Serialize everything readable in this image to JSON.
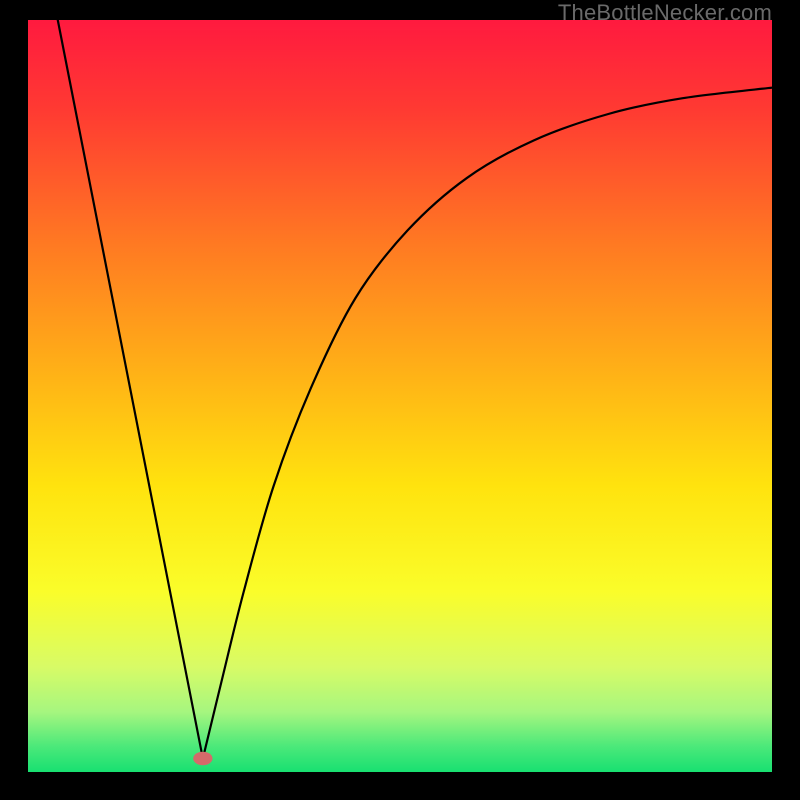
{
  "watermark": "TheBottleNecker.com",
  "chart_data": {
    "type": "line",
    "title": "",
    "xlabel": "",
    "ylabel": "",
    "xlim": [
      0,
      1
    ],
    "ylim": [
      0,
      1
    ],
    "gradient_stops": [
      {
        "offset": 0.0,
        "color": "#ff1a3f"
      },
      {
        "offset": 0.12,
        "color": "#ff3a32"
      },
      {
        "offset": 0.3,
        "color": "#ff7a22"
      },
      {
        "offset": 0.48,
        "color": "#ffb516"
      },
      {
        "offset": 0.62,
        "color": "#ffe30e"
      },
      {
        "offset": 0.76,
        "color": "#fafd2a"
      },
      {
        "offset": 0.86,
        "color": "#d8fb66"
      },
      {
        "offset": 0.92,
        "color": "#a6f67f"
      },
      {
        "offset": 0.965,
        "color": "#4de97a"
      },
      {
        "offset": 1.0,
        "color": "#18e071"
      }
    ],
    "curve": {
      "minimum_x": 0.235,
      "left_branch": [
        {
          "x": 0.04,
          "y": 1.0
        },
        {
          "x": 0.235,
          "y": 0.018
        }
      ],
      "right_branch": [
        {
          "x": 0.235,
          "y": 0.018
        },
        {
          "x": 0.26,
          "y": 0.12
        },
        {
          "x": 0.29,
          "y": 0.24
        },
        {
          "x": 0.33,
          "y": 0.38
        },
        {
          "x": 0.38,
          "y": 0.51
        },
        {
          "x": 0.44,
          "y": 0.63
        },
        {
          "x": 0.51,
          "y": 0.72
        },
        {
          "x": 0.59,
          "y": 0.79
        },
        {
          "x": 0.68,
          "y": 0.84
        },
        {
          "x": 0.78,
          "y": 0.875
        },
        {
          "x": 0.88,
          "y": 0.896
        },
        {
          "x": 1.0,
          "y": 0.91
        }
      ]
    },
    "marker": {
      "x": 0.235,
      "y": 0.018,
      "rx": 0.013,
      "ry": 0.009,
      "color": "#d46a6a"
    }
  }
}
